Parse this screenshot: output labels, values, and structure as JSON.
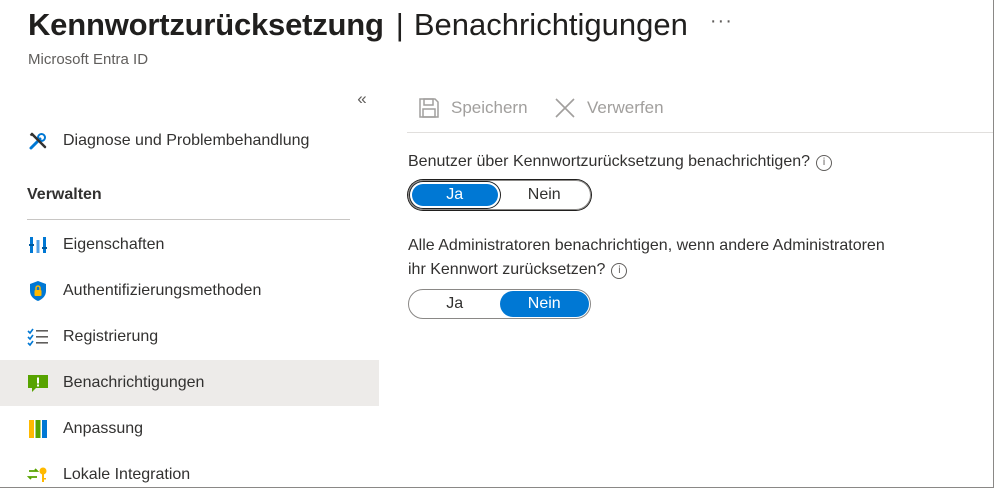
{
  "header": {
    "title_main": "Kennwortzurücksetzung",
    "title_separator": "|",
    "title_sub": "Benachrichtigungen",
    "more_label": "···",
    "subtitle": "Microsoft Entra ID"
  },
  "sidebar": {
    "collapse_label": "«",
    "diagnose": {
      "label": "Diagnose und Problembehandlung",
      "icon": "wrench-screwdriver-icon"
    },
    "section_title": "Verwalten",
    "items": [
      {
        "label": "Eigenschaften",
        "icon": "properties-bars-icon",
        "selected": false
      },
      {
        "label": "Authentifizierungsmethoden",
        "icon": "shield-lock-icon",
        "selected": false
      },
      {
        "label": "Registrierung",
        "icon": "checklist-icon",
        "selected": false
      },
      {
        "label": "Benachrichtigungen",
        "icon": "notification-icon",
        "selected": true
      },
      {
        "label": "Anpassung",
        "icon": "customization-columns-icon",
        "selected": false
      },
      {
        "label": "Lokale Integration",
        "icon": "sync-key-icon",
        "selected": false
      }
    ]
  },
  "toolbar": {
    "save_label": "Speichern",
    "discard_label": "Verwerfen"
  },
  "settings": {
    "q1": {
      "label": "Benutzer über Kennwortzurücksetzung benachrichtigen?",
      "options": [
        "Ja",
        "Nein"
      ],
      "selected": "Ja"
    },
    "q2": {
      "label_line1": "Alle Administratoren benachrichtigen, wenn andere Administratoren",
      "label_line2": "ihr Kennwort zurücksetzen?",
      "options": [
        "Ja",
        "Nein"
      ],
      "selected": "Nein"
    }
  },
  "colors": {
    "accent": "#0078d4",
    "selected_bg": "#edebe9",
    "disabled_text": "#a19f9d"
  }
}
